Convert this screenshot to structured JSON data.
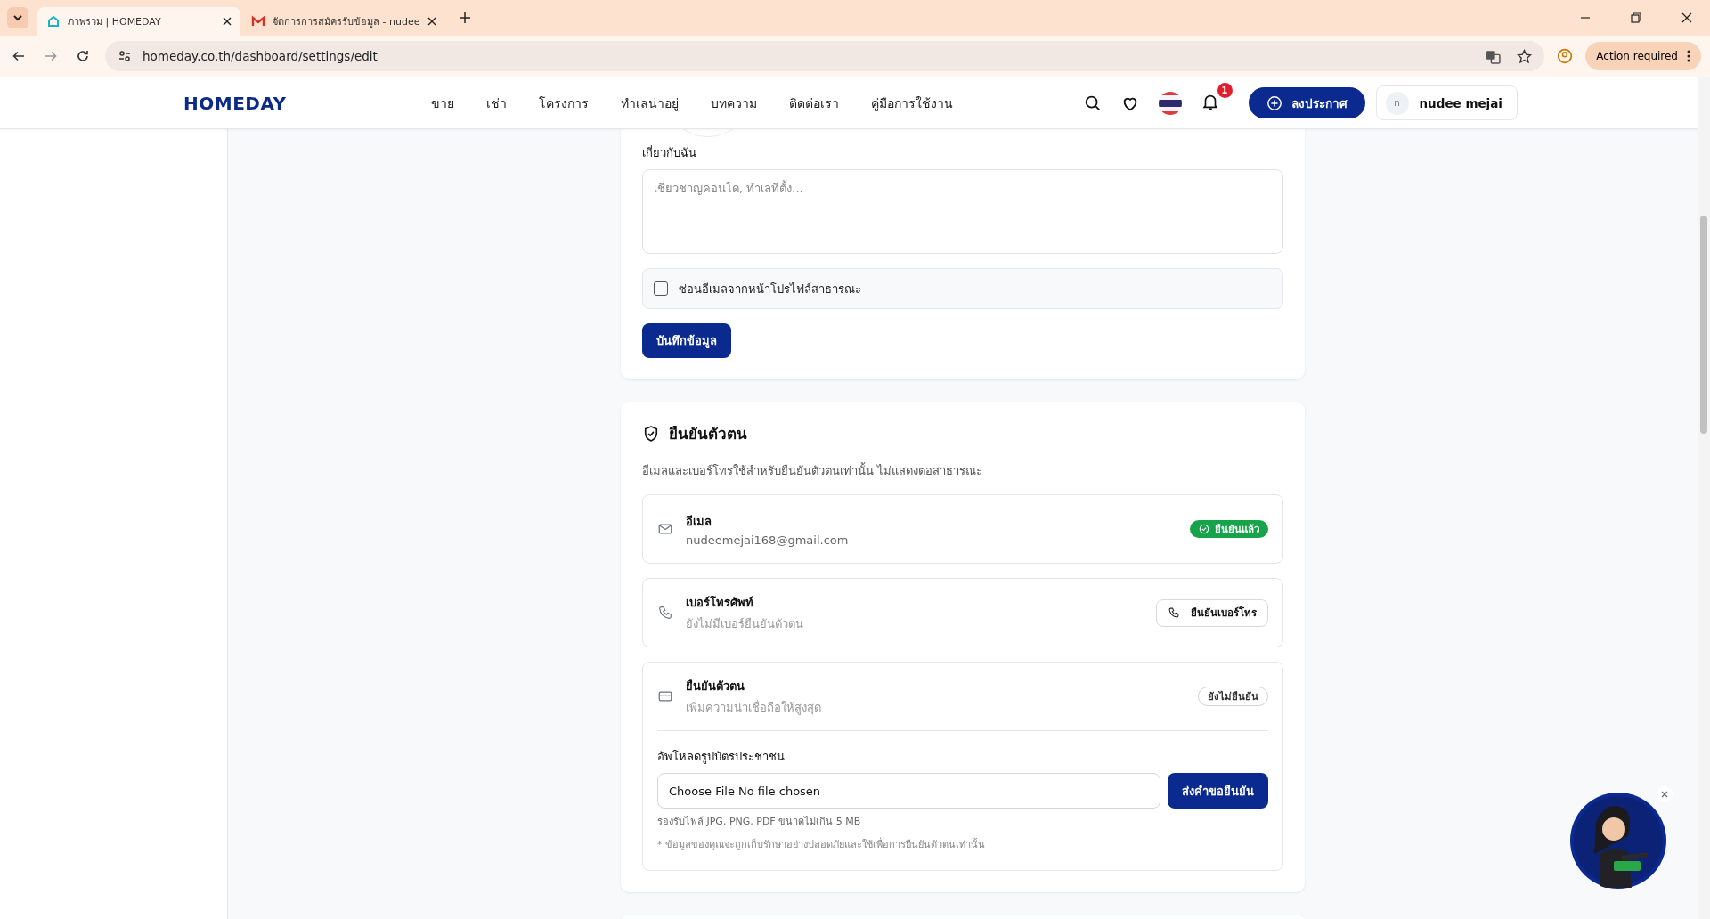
{
  "browser": {
    "tabs": [
      {
        "title": "ภาพรวม | HOMEDAY",
        "selected": true,
        "kind": "home"
      },
      {
        "title": "จัดการการสมัครรับข้อมูล - nudee",
        "selected": false,
        "kind": "mail"
      }
    ],
    "url": "homeday.co.th/dashboard/settings/edit",
    "action": "Action required"
  },
  "nav": {
    "logo": "HOMEDAY",
    "links": [
      "ขาย",
      "เช่า",
      "โครงการ",
      "ทำเลน่าอยู่",
      "บทความ",
      "ติดต่อเรา",
      "คู่มือการใช้งาน"
    ],
    "notification_count": "1",
    "post_button": "ลงประกาศ",
    "user": {
      "initial": "n",
      "name": "nudee mejai"
    }
  },
  "profile_form": {
    "about_label": "เกี่ยวกับฉัน",
    "about_placeholder": "เชี่ยวชาญคอนโด, ทำเลที่ตั้ง...",
    "hide_email": {
      "label": "ซ่อนอีเมลจากหน้าโปรไฟล์สาธารณะ",
      "checked": false
    },
    "save_button": "บันทึกข้อมูล"
  },
  "verification": {
    "title": "ยืนยันตัวตน",
    "description": "อีเมลและเบอร์โทรใช้สำหรับยืนยันตัวตนเท่านั้น ไม่แสดงต่อสาธารณะ",
    "items": [
      {
        "kind": "email",
        "label": "อีเมล",
        "value": "nudeemejai168@gmail.com",
        "status": {
          "kind": "verified",
          "text": "ยืนยันแล้ว"
        }
      },
      {
        "kind": "phone",
        "label": "เบอร์โทรศัพท์",
        "value": "ยังไม่มีเบอร์ยืนยันตัวตน",
        "status": {
          "kind": "action",
          "text": "ยืนยันเบอร์โทร"
        }
      },
      {
        "kind": "id",
        "label": "ยืนยันตัวตน",
        "value": "เพิ่มความน่าเชื่อถือให้สูงสุด",
        "status": {
          "kind": "pending",
          "text": "ยังไม่ยืนยัน"
        },
        "upload": {
          "label": "อัพโหลดรูปบัตรประชาชน",
          "file_field": "Choose File No file chosen",
          "submit": "ส่งคำขอยืนยัน",
          "hint": "รองรับไฟล์ JPG, PNG, PDF ขนาดไม่เกิน 5 MB",
          "note": "* ข้อมูลของคุณจะถูกเก็บรักษาอย่างปลอดภัยและใช้เพื่อการยืนยันตัวตนเท่านั้น"
        }
      }
    ]
  }
}
